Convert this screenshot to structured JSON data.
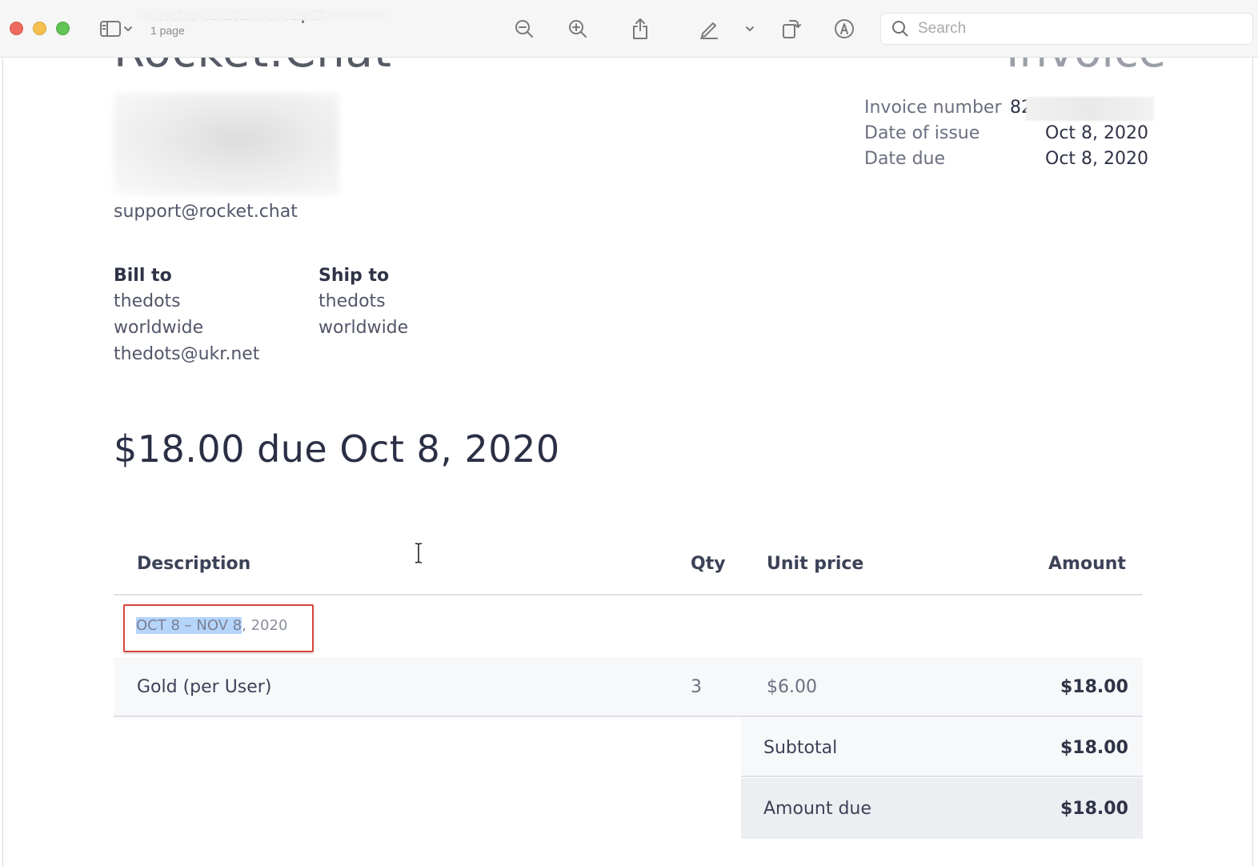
{
  "window": {
    "doc_title": "Invoice-82025180-0002.pdf",
    "doc_subtitle": "1 page",
    "search_placeholder": "Search"
  },
  "toolbar_icons": [
    "sidebar-icon",
    "chevron-down-icon",
    "zoom-out-icon",
    "zoom-in-icon",
    "share-icon",
    "markup-pen-icon",
    "chevron-down-icon",
    "rotate-icon",
    "annotate-icon",
    "search-icon"
  ],
  "invoice": {
    "brand_text": "Rocket.Chat",
    "doc_type": "Invoice",
    "support_email": "support@rocket.chat",
    "meta": {
      "invoice_number_label": "Invoice number",
      "invoice_number_value": "82",
      "date_of_issue_label": "Date of issue",
      "date_of_issue_value": "Oct 8, 2020",
      "date_due_label": "Date due",
      "date_due_value": "Oct 8, 2020"
    },
    "bill_to": {
      "heading": "Bill to",
      "lines": [
        "thedots",
        "worldwide",
        "thedots@ukr.net"
      ]
    },
    "ship_to": {
      "heading": "Ship to",
      "lines": [
        "thedots",
        "worldwide"
      ]
    },
    "headline": "$18.00 due Oct 8, 2020",
    "table": {
      "headers": {
        "description": "Description",
        "qty": "Qty",
        "unit_price": "Unit price",
        "amount": "Amount"
      },
      "period_selected": "OCT 8 – NOV 8",
      "period_rest": ", 2020",
      "rows": [
        {
          "description": "Gold (per User)",
          "qty": "3",
          "unit_price": "$6.00",
          "amount": "$18.00"
        }
      ],
      "subtotal_label": "Subtotal",
      "subtotal_value": "$18.00",
      "amount_due_label": "Amount due",
      "amount_due_value": "$18.00"
    }
  },
  "colors": {
    "selection_highlight": "#b5d5fb",
    "annotation_box": "#d9443b",
    "text_dark": "#2f3347"
  }
}
